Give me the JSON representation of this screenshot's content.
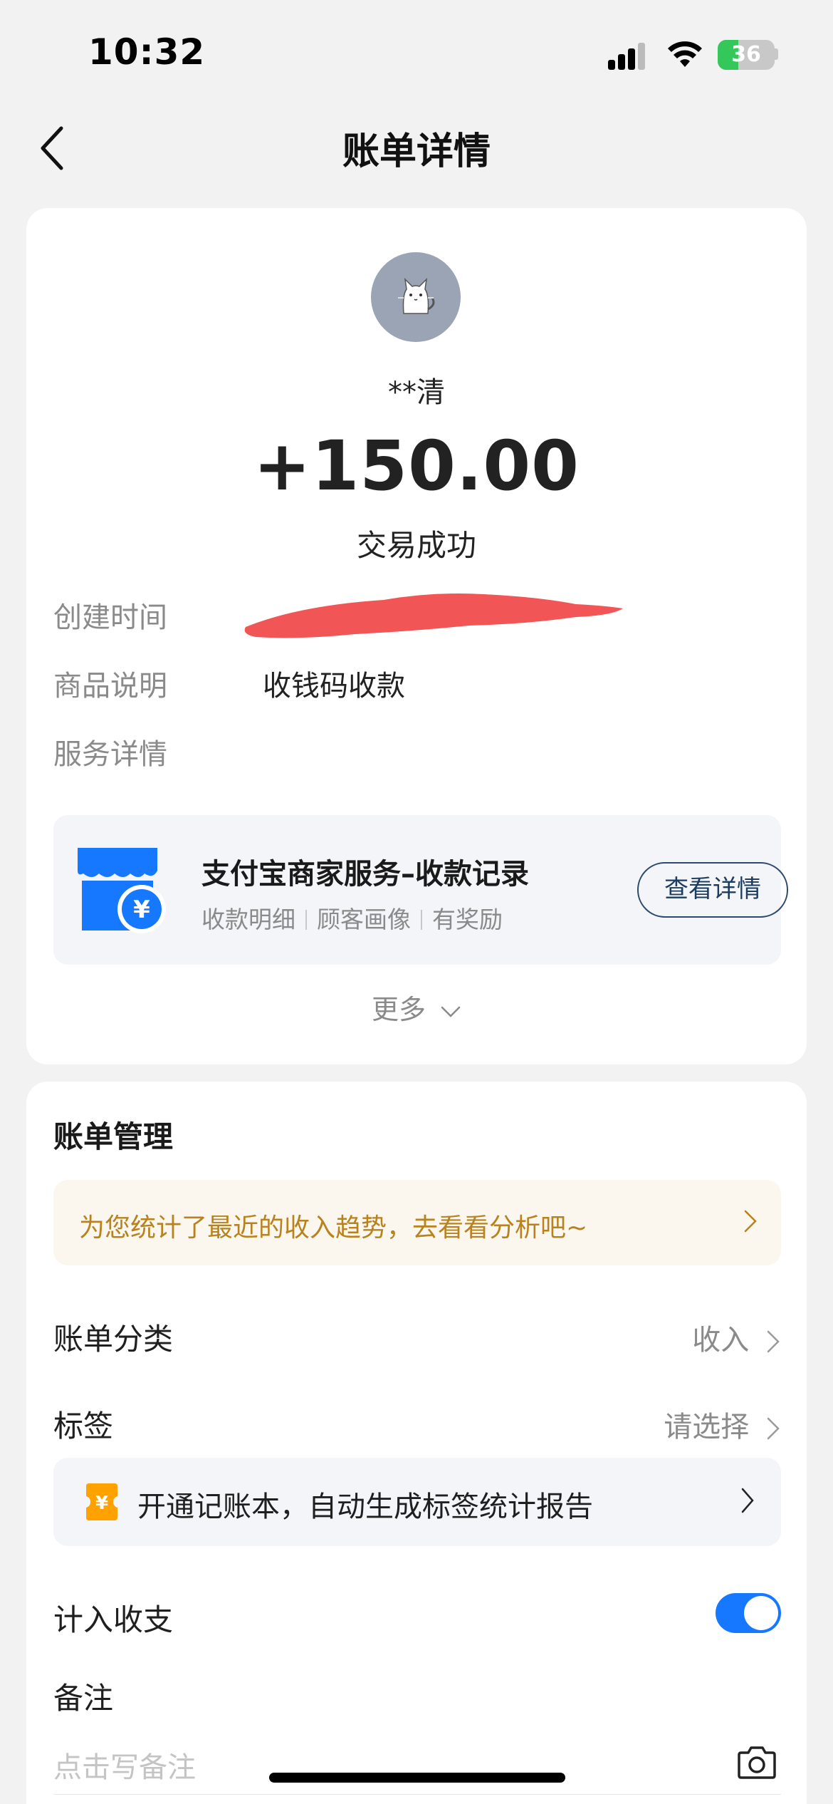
{
  "status_bar": {
    "time": "10:32",
    "battery": "36"
  },
  "nav": {
    "title": "账单详情"
  },
  "transaction": {
    "name": "**清",
    "amount": "+150.00",
    "status": "交易成功",
    "rows": {
      "created_label": "创建时间",
      "product_label": "商品说明",
      "product_value": "收钱码收款",
      "service_label": "服务详情"
    },
    "service": {
      "title": "支付宝商家服务–收款记录",
      "tags": [
        "收款明细",
        "顾客画像",
        "有奖励"
      ],
      "button": "查看详情"
    },
    "more": "更多"
  },
  "manage": {
    "title": "账单管理",
    "trend_tip": "为您统计了最近的收入趋势，去看看分析吧~",
    "category_label": "账单分类",
    "category_value": "收入",
    "tag_label": "标签",
    "tag_value": "请选择",
    "ledger_tip": "开通记账本，自动生成标签统计报告",
    "count_label": "计入收支",
    "count_on": true,
    "note_label": "备注",
    "note_placeholder": "点击写备注"
  },
  "colors": {
    "accent_blue": "#1677ff",
    "trend_text": "#b8821e",
    "redaction": "#f25555"
  },
  "icons": [
    "back-arrow-icon",
    "cat-avatar-icon",
    "shop-yuan-icon",
    "chevron-down-icon",
    "chevron-right-icon",
    "yuan-ledger-icon",
    "camera-icon"
  ]
}
